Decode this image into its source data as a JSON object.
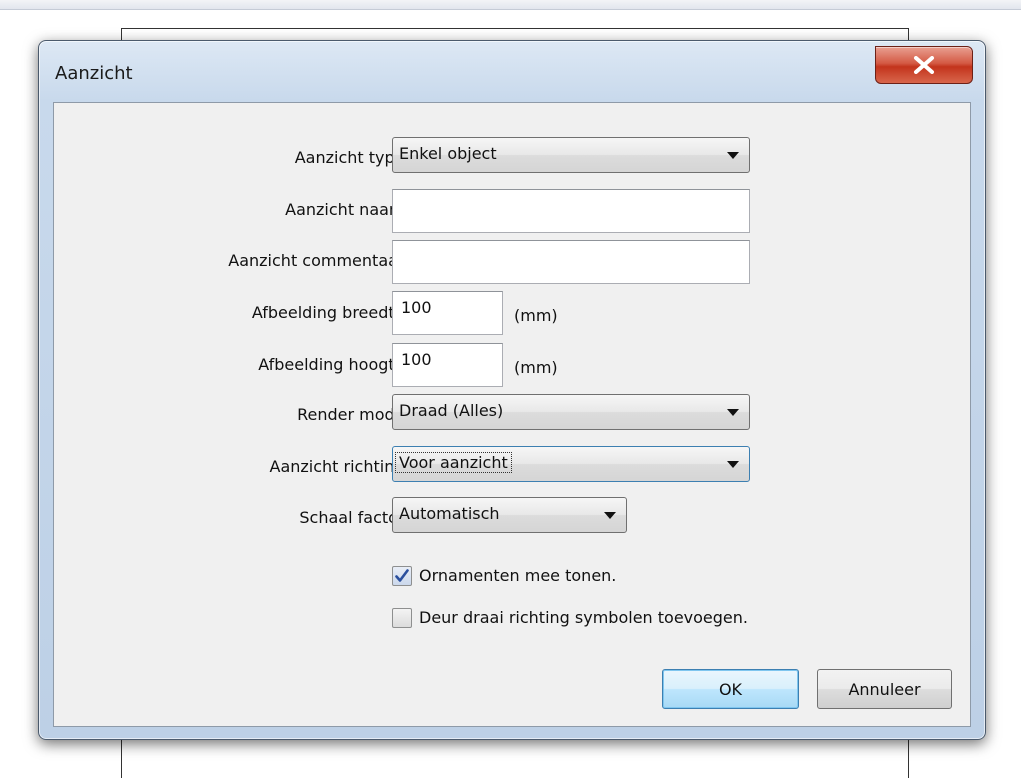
{
  "window": {
    "title": "Aanzicht"
  },
  "form": {
    "view_type": {
      "label": "Aanzicht type =",
      "value": "Enkel object"
    },
    "view_name": {
      "label": "Aanzicht naam =",
      "value": ""
    },
    "view_comment": {
      "label": "Aanzicht commentaar =",
      "value": ""
    },
    "image_width": {
      "label": "Afbeelding breedte =",
      "value": "100",
      "unit": "(mm)"
    },
    "image_height": {
      "label": "Afbeelding hoogte =",
      "value": "100",
      "unit": "(mm)"
    },
    "render_mode": {
      "label": "Render mode =",
      "value": "Draad (Alles)"
    },
    "view_direction": {
      "label": "Aanzicht richting =",
      "value": "Voor aanzicht"
    },
    "scale_factor": {
      "label": "Schaal factor =",
      "value": "Automatisch"
    },
    "show_ornaments": {
      "label": "Ornamenten mee tonen.",
      "checked": true
    },
    "door_symbols": {
      "label": "Deur draai richting symbolen toevoegen.",
      "checked": false
    }
  },
  "buttons": {
    "ok": "OK",
    "cancel": "Annuleer"
  },
  "colors": {
    "close_button": "#c3341c",
    "accent": "#3c7fb1",
    "client_bg": "#f0f0f0"
  }
}
